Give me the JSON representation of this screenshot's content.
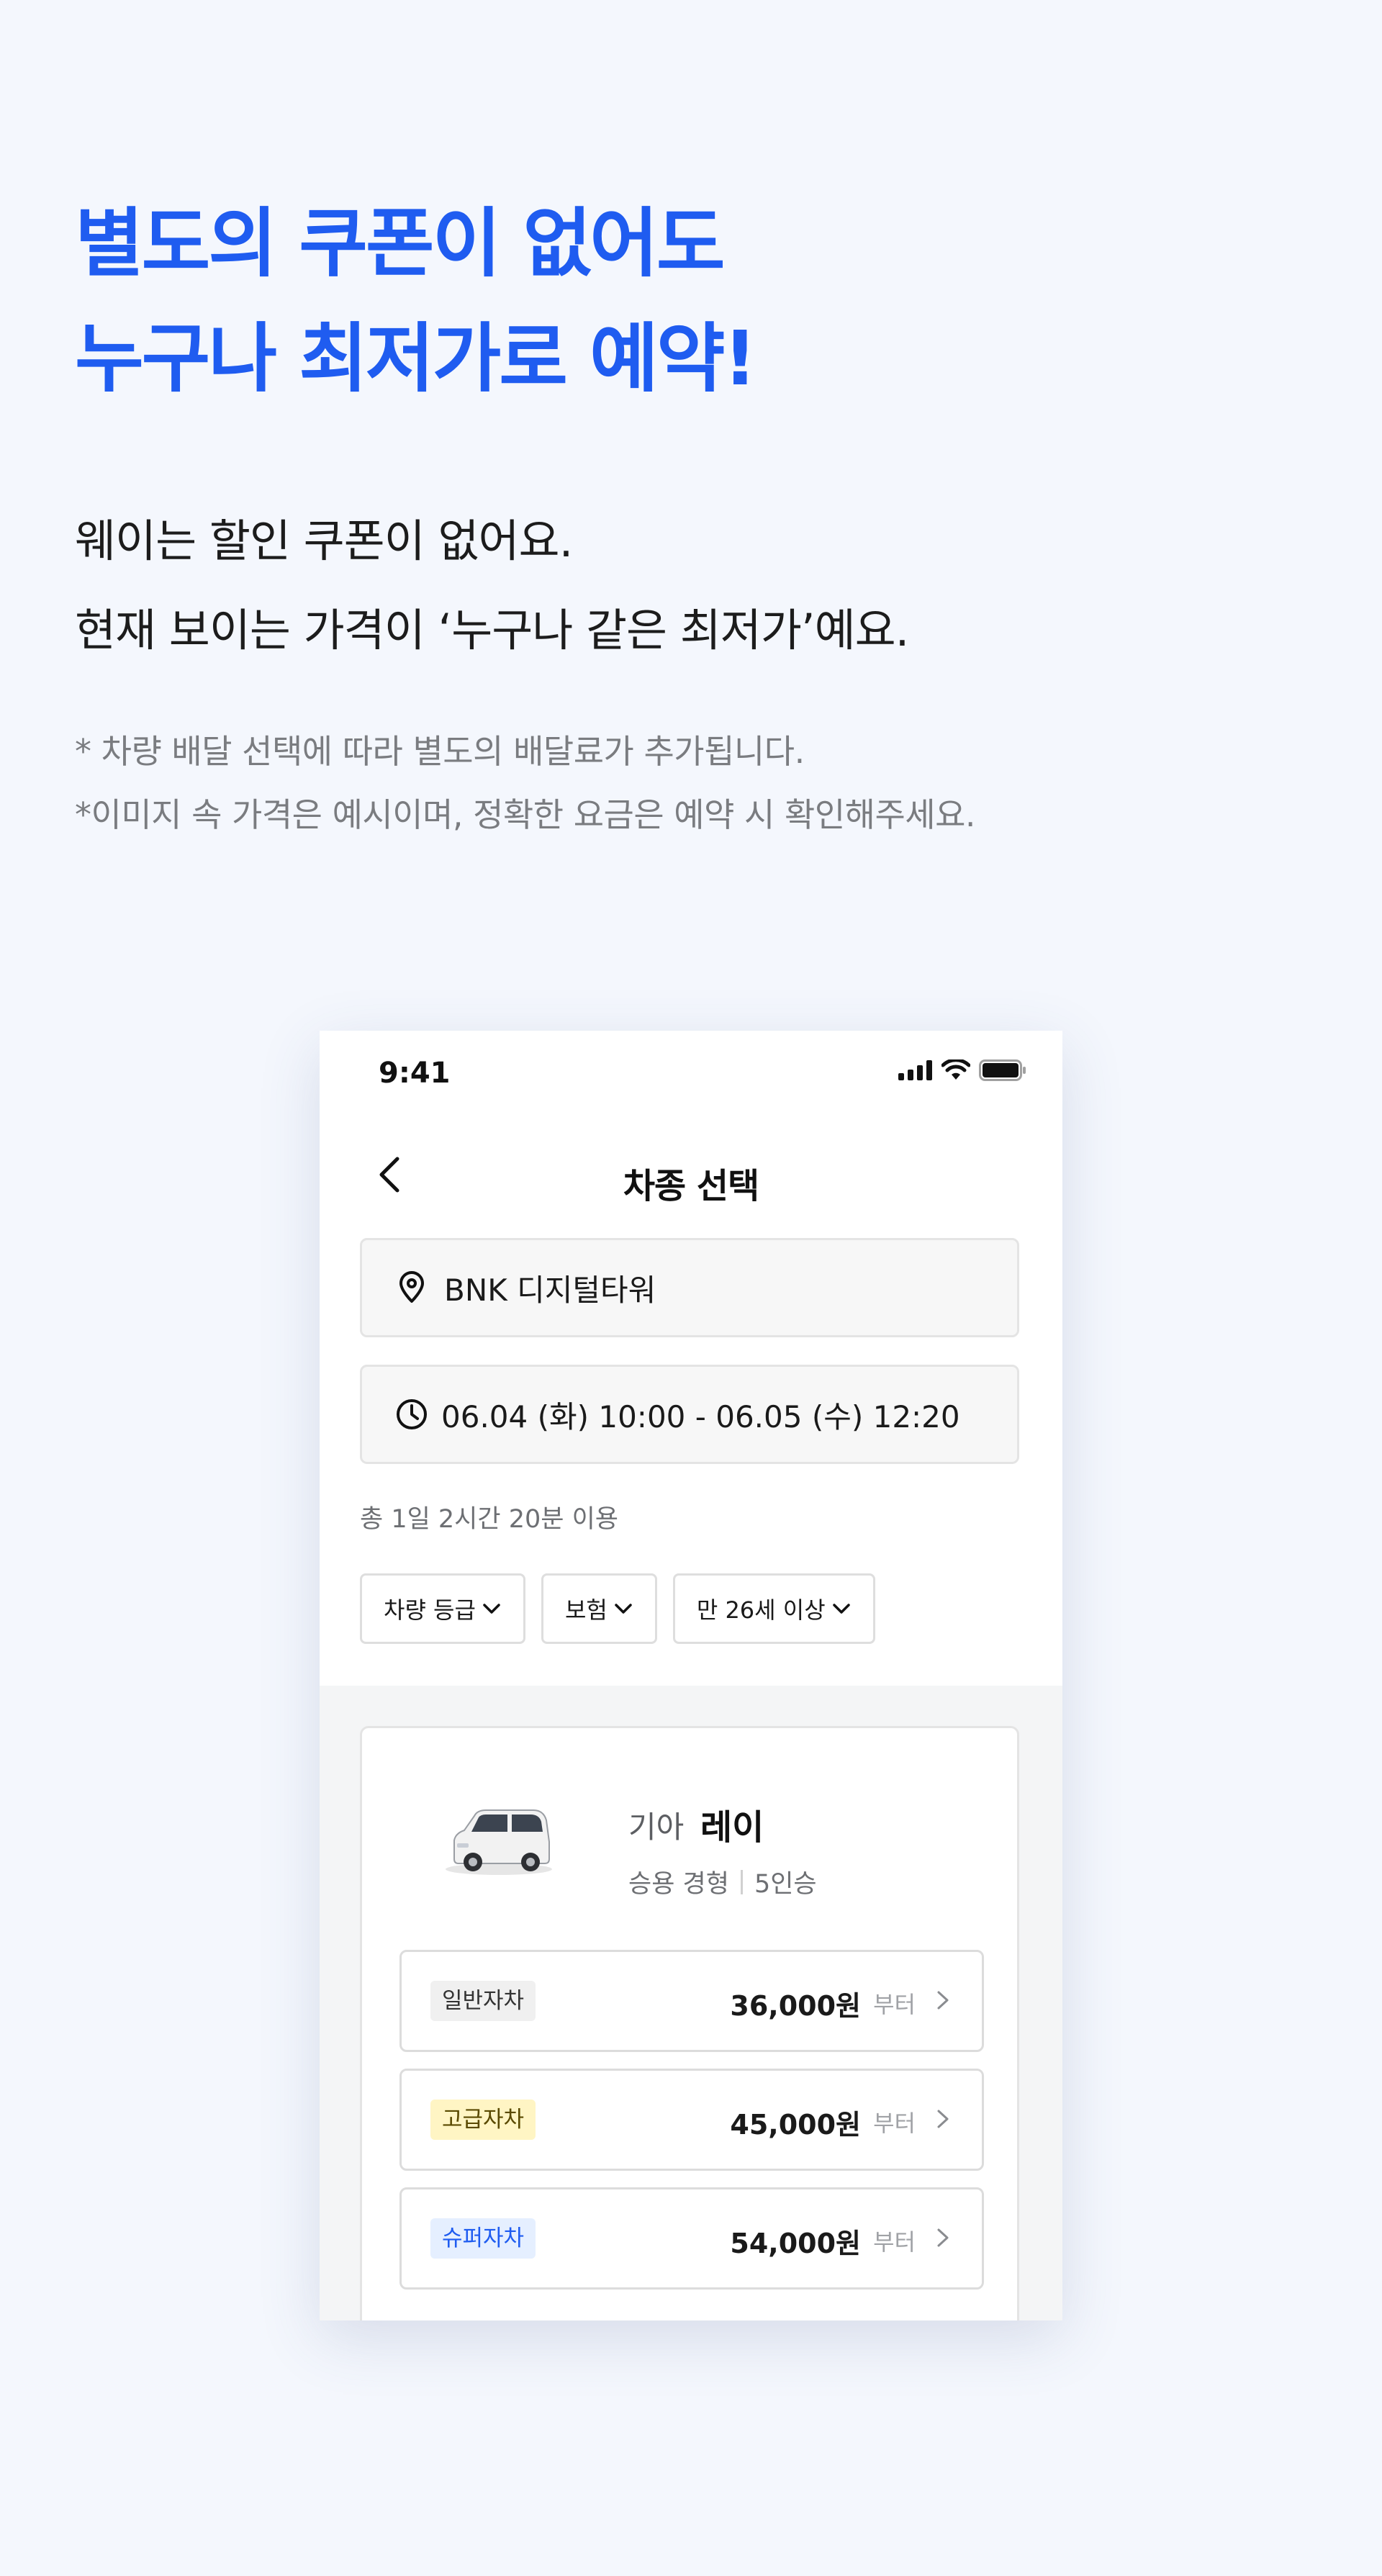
{
  "headline": {
    "line1": "별도의 쿠폰이 없어도",
    "line2": "누구나 최저가로 예약!"
  },
  "subcopy": {
    "line1": "웨이는 할인 쿠폰이 없어요.",
    "line2": "현재 보이는 가격이 ‘누구나 같은 최저가’예요."
  },
  "footnotes": {
    "line1": "* 차량 배달 선택에 따라 별도의 배달료가 추가됩니다.",
    "line2": "*이미지 속 가격은 예시이며, 정확한 요금은 예약 시 확인해주세요."
  },
  "phone": {
    "status_time": "9:41",
    "nav_title": "차종 선택",
    "location": "BNK 디지털타워",
    "datetime": "06.04 (화) 10:00  -  06.05 (수) 12:20",
    "duration": "총 1일 2시간 20분 이용",
    "filters": [
      {
        "label": "차량 등급"
      },
      {
        "label": "보험"
      },
      {
        "label": "만 26세 이상"
      }
    ],
    "car": {
      "brand": "기아",
      "model": "레이",
      "spec_type": "승용 경형",
      "spec_seats": "5인승",
      "options": [
        {
          "badge": "일반자차",
          "price": "36,000원",
          "suffix": "부터"
        },
        {
          "badge": "고급자차",
          "price": "45,000원",
          "suffix": "부터"
        },
        {
          "badge": "슈퍼자차",
          "price": "54,000원",
          "suffix": "부터"
        }
      ]
    }
  },
  "colors": {
    "accent": "#1f5cf0",
    "background": "#f4f7fd",
    "badge_general": "#f0f0f0",
    "badge_premium": "#fff5c4",
    "badge_super": "#e5efff"
  },
  "icons": {
    "back": "chevron-left-icon",
    "location": "map-pin-icon",
    "time": "clock-icon",
    "filter_chevron": "chevron-down-icon",
    "option_arrow": "chevron-right-icon",
    "signal": "signal-icon",
    "wifi": "wifi-icon",
    "battery": "battery-icon"
  }
}
